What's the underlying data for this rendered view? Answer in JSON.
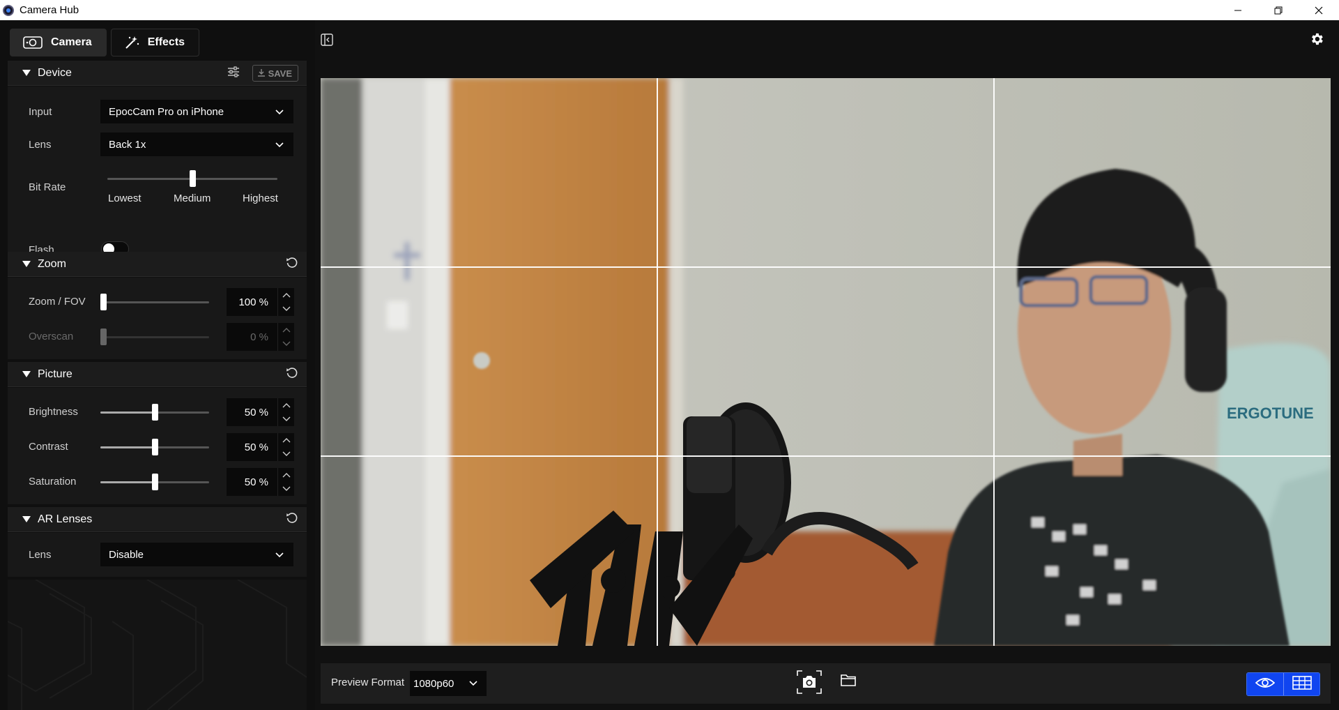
{
  "window": {
    "title": "Camera Hub",
    "minimize": "—",
    "maximize": "❐",
    "close": "✕"
  },
  "tabs": [
    {
      "label": "Camera",
      "active": true,
      "icon": "camera-icon"
    },
    {
      "label": "Effects",
      "active": false,
      "icon": "magic-wand-icon"
    }
  ],
  "device": {
    "title": "Device",
    "save_label": "SAVE",
    "input_label": "Input",
    "input_value": "EpocCam Pro on iPhone",
    "lens_label": "Lens",
    "lens_value": "Back 1x",
    "bitrate_label": "Bit Rate",
    "bitrate_ticks": [
      "Lowest",
      "Medium",
      "Highest"
    ],
    "bitrate_level": 0.5,
    "flash_label": "Flash",
    "flash_on": false
  },
  "zoom": {
    "title": "Zoom",
    "zoom_label": "Zoom / FOV",
    "zoom_value": "100 %",
    "zoom_level": 0,
    "overscan_label": "Overscan",
    "overscan_value": "0 %",
    "overscan_level": 0
  },
  "picture": {
    "title": "Picture",
    "brightness_label": "Brightness",
    "brightness_value": "50 %",
    "contrast_label": "Contrast",
    "contrast_value": "50 %",
    "saturation_label": "Saturation",
    "saturation_value": "50 %"
  },
  "ar_lenses": {
    "title": "AR Lenses",
    "lens_label": "Lens",
    "lens_value": "Disable"
  },
  "bottom": {
    "preview_format_label": "Preview Format",
    "preview_format_value": "1080p60"
  },
  "colors": {
    "accent": "#1045f0",
    "panel": "#181818",
    "header": "#1c1c1c"
  }
}
